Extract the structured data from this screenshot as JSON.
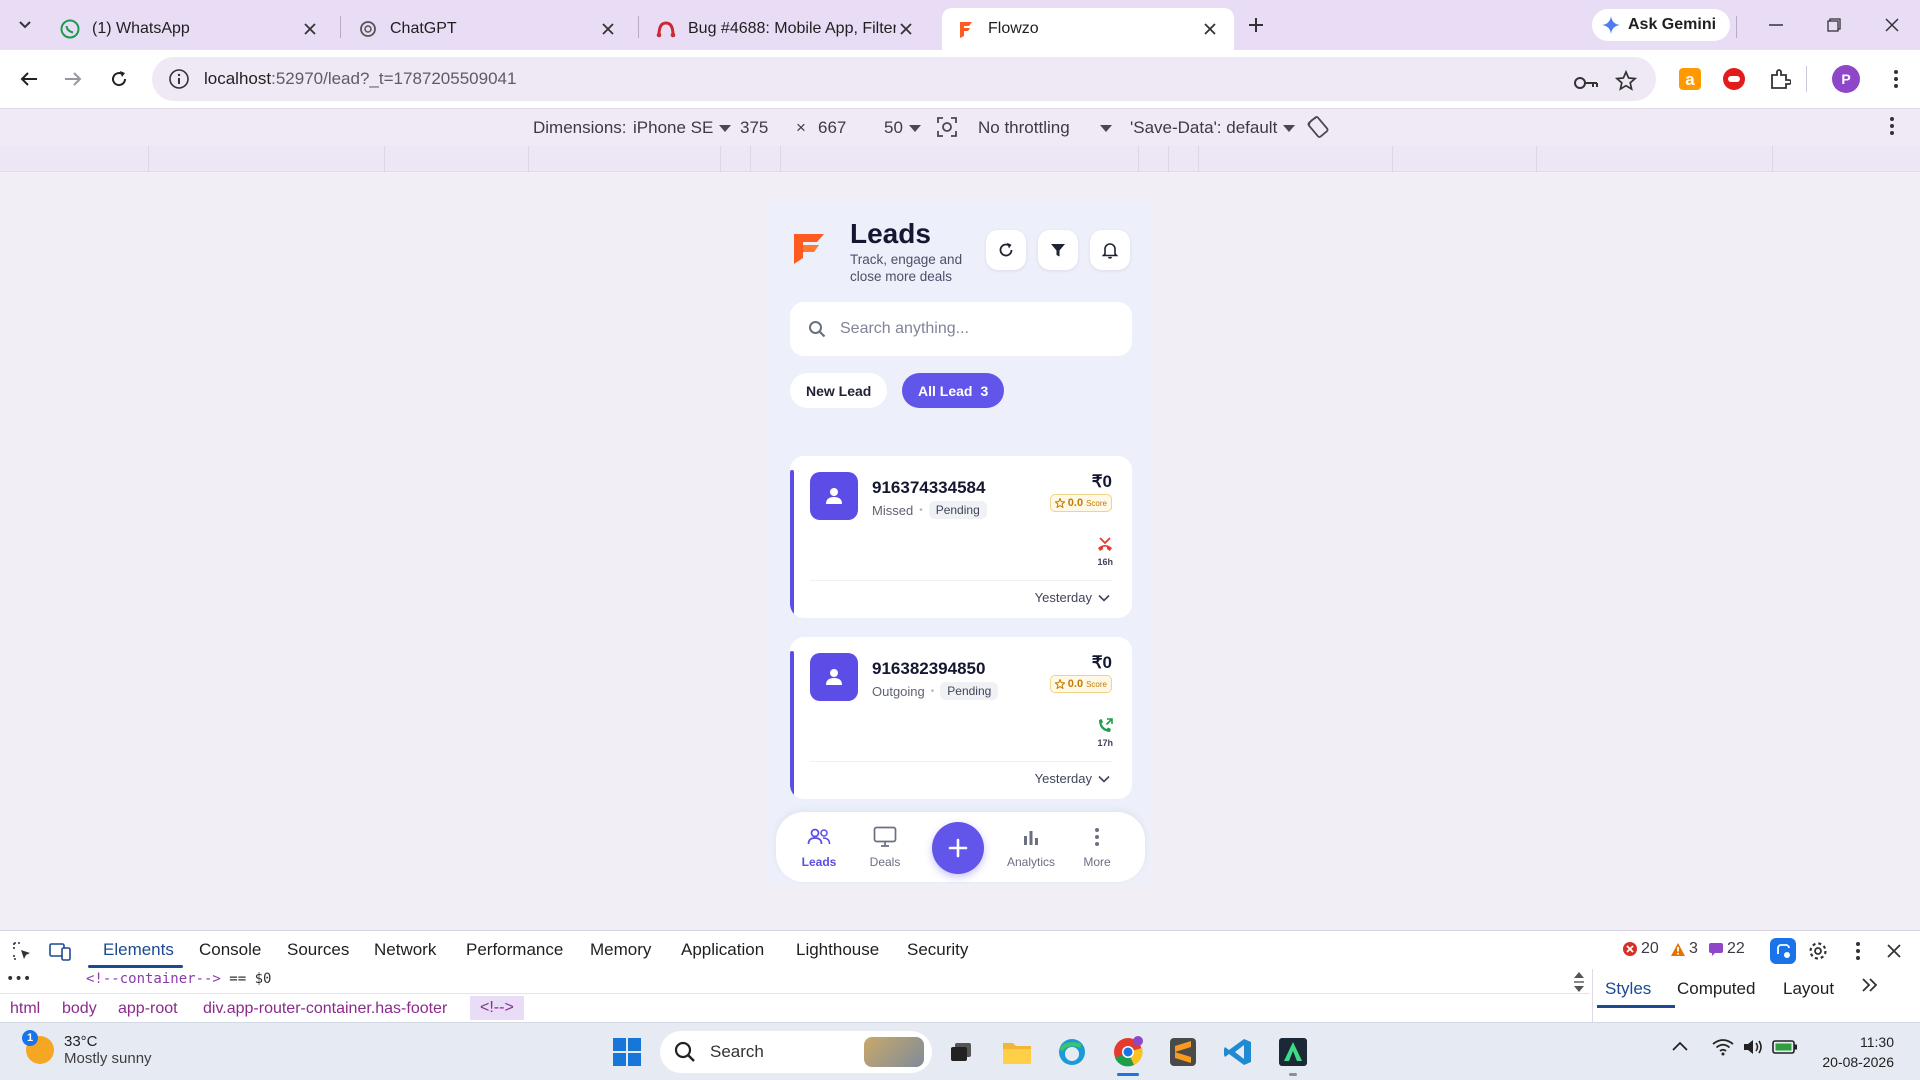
{
  "browser": {
    "tabs": [
      {
        "title": "(1) WhatsApp",
        "icon": "whatsapp-icon"
      },
      {
        "title": "ChatGPT",
        "icon": "chatgpt-icon"
      },
      {
        "title": "Bug #4688: Mobile App, Filter ic",
        "icon": "azure-devops-icon"
      },
      {
        "title": "Flowzo",
        "icon": "flowzo-icon",
        "active": true
      }
    ],
    "gemini_label": "Ask Gemini",
    "url_host": "localhost",
    "url_rest": ":52970/lead?_t=1787205509041",
    "profile_initial": "P"
  },
  "device_toolbar": {
    "dimensions_label": "Dimensions:",
    "device": "iPhone SE",
    "width": "375",
    "times": "×",
    "height": "667",
    "zoom": "50",
    "throttling": "No throttling",
    "save_data": "'Save-Data': default"
  },
  "app": {
    "title": "Leads",
    "subtitle": "Track, engage and close more deals",
    "search_placeholder": "Search anything...",
    "chips": {
      "new_lead": "New Lead",
      "all_lead": "All Lead",
      "all_count": "3"
    },
    "leads": [
      {
        "phone": "916374334584",
        "direction": "Missed",
        "status": "Pending",
        "amount": "₹0",
        "score": "0.0",
        "score_label": "Score",
        "call_type": "missed",
        "duration": "16h",
        "when": "Yesterday"
      },
      {
        "phone": "916382394850",
        "direction": "Outgoing",
        "status": "Pending",
        "amount": "₹0",
        "score": "0.0",
        "score_label": "Score",
        "call_type": "outgoing",
        "duration": "17h",
        "when": "Yesterday"
      }
    ],
    "nav": {
      "leads": "Leads",
      "deals": "Deals",
      "analytics": "Analytics",
      "more": "More"
    },
    "colors": {
      "primary": "#6155ea",
      "accent_logo": "#ff5a1f",
      "missed": "#e53935",
      "outgoing": "#1e9e4a"
    }
  },
  "devtools": {
    "tabs": [
      "Elements",
      "Console",
      "Sources",
      "Network",
      "Performance",
      "Memory",
      "Application",
      "Lighthouse",
      "Security"
    ],
    "errors": "20",
    "warnings": "3",
    "issues": "22",
    "code_line": "<!--container-->",
    "code_suffix": "== $0",
    "breadcrumbs": [
      "html",
      "body",
      "app-root",
      "div.app-router-container.has-footer",
      "<!-->"
    ],
    "side_tabs": [
      "Styles",
      "Computed",
      "Layout"
    ]
  },
  "taskbar": {
    "weather_temp": "33°C",
    "weather_desc": "Mostly sunny",
    "weather_badge": "1",
    "search_label": "Search",
    "time": "11:30",
    "date": "20-08-2026"
  }
}
